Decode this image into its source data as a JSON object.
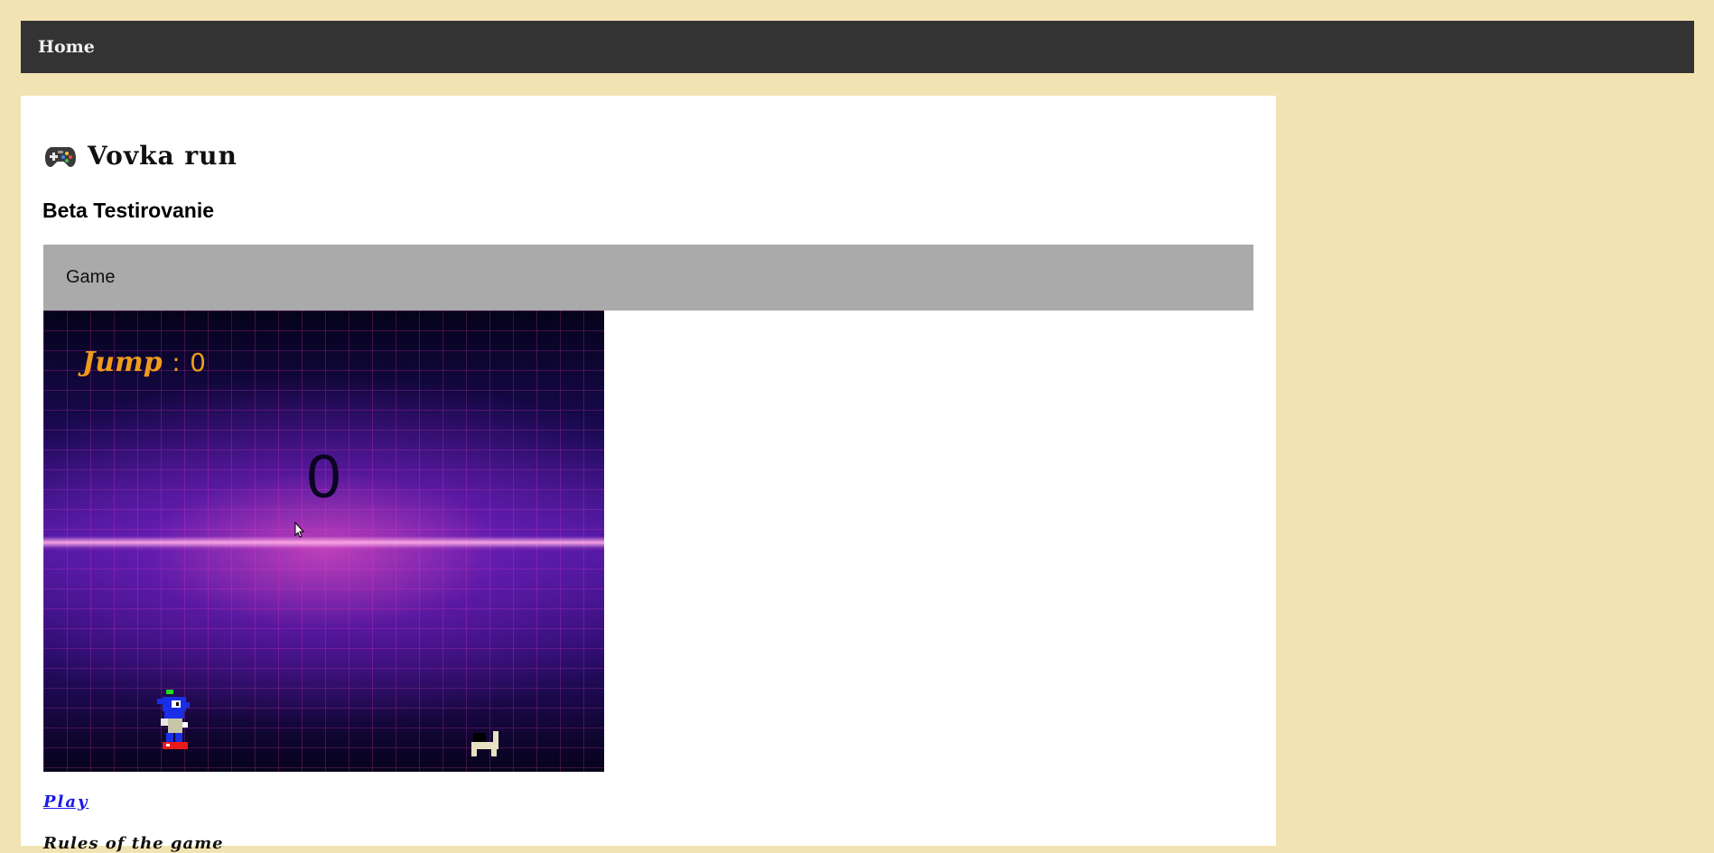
{
  "nav": {
    "home_label": "Home"
  },
  "header": {
    "title": "Vovka run",
    "subtitle": "Beta Testirovanie"
  },
  "game": {
    "section_label": "Game",
    "jump_label": "Jump",
    "jump_separator": ":",
    "jump_count": "0",
    "score": "0"
  },
  "actions": {
    "play_label": "Play"
  },
  "rules": {
    "heading": "Rules of the game"
  },
  "icons": {
    "title_icon": "gamepad-icon"
  },
  "colors": {
    "page_bg": "#f2e3b2",
    "nav_bg": "#333333",
    "game_bar_bg": "#aaaaaa",
    "jump_text": "#f09a1c",
    "link": "#1a1ae8"
  }
}
